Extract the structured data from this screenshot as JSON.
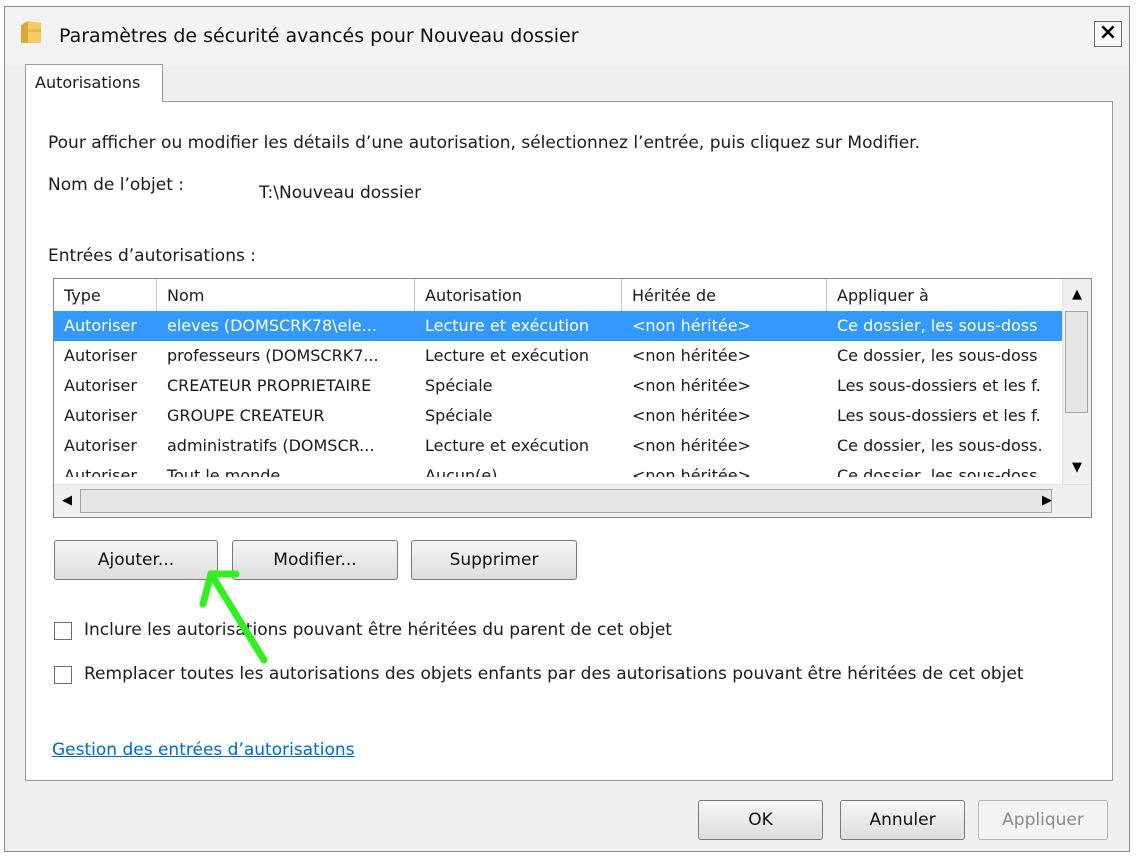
{
  "window": {
    "title": "Paramètres de sécurité avancés pour Nouveau dossier",
    "close_label": "×"
  },
  "tab": {
    "label": "Autorisations"
  },
  "instructions": "Pour afficher ou modifier les détails d’une autorisation, sélectionnez l’entrée, puis cliquez sur Modifier.",
  "object": {
    "label": "Nom de l’objet :",
    "value": "T:\\Nouveau dossier"
  },
  "entries": {
    "label": "Entrées d’autorisations :",
    "columns": [
      "Type",
      "Nom",
      "Autorisation",
      "Héritée de",
      "Appliquer à"
    ],
    "rows": [
      [
        "Autoriser",
        "eleves (DOMSCRK78\\ele...",
        "Lecture et exécution",
        "<non héritée>",
        "Ce dossier, les sous-doss"
      ],
      [
        "Autoriser",
        "professeurs (DOMSCRK7...",
        "Lecture et exécution",
        "<non héritée>",
        "Ce dossier, les sous-doss"
      ],
      [
        "Autoriser",
        "CREATEUR PROPRIETAIRE",
        "Spéciale",
        "<non héritée>",
        "Les sous-dossiers et les f."
      ],
      [
        "Autoriser",
        "GROUPE CREATEUR",
        "Spéciale",
        "<non héritée>",
        "Les sous-dossiers et les f."
      ],
      [
        "Autoriser",
        "administratifs (DOMSCR...",
        "Lecture et exécution",
        "<non héritée>",
        "Ce dossier, les sous-doss."
      ],
      [
        "Autoriser",
        "Tout le monde",
        "Aucun(e)",
        "<non héritée>",
        "Ce dossier, les sous-doss"
      ]
    ],
    "selected_row": 0
  },
  "buttons": {
    "add": "Ajouter...",
    "modify": "Modifier...",
    "delete": "Supprimer"
  },
  "checkboxes": {
    "include_inheritable": {
      "label": "Inclure les autorisations pouvant être héritées du parent de cet objet",
      "checked": false
    },
    "replace_children": {
      "label": "Remplacer toutes les autorisations des objets enfants par des autorisations pouvant être héritées de cet objet",
      "checked": false
    }
  },
  "link": "Gestion des entrées d’autorisations",
  "footer": {
    "ok": "OK",
    "cancel": "Annuler",
    "apply": "Appliquer"
  },
  "colors": {
    "selection": "#3399ff",
    "link": "#0066cc",
    "annotation_arrow": "#33ee22"
  }
}
